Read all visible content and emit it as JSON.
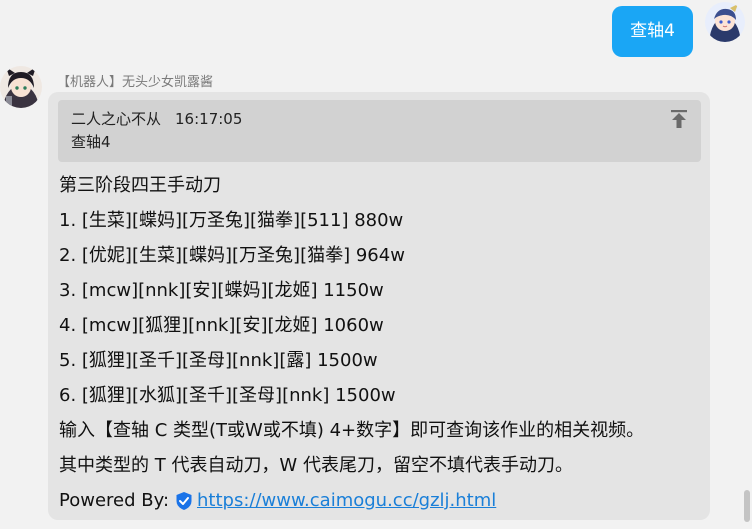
{
  "self_message": {
    "text": "查轴4"
  },
  "bot": {
    "name": "【机器人】无头少女凯露酱",
    "quote": {
      "author": "二人之心不从",
      "time": "16:17:05",
      "text": "查轴4"
    },
    "lines": [
      "第三阶段四王手动刀",
      "1. [生菜][蝶妈][万圣兔][猫拳][511] 880w",
      "2. [优妮][生菜][蝶妈][万圣兔][猫拳] 964w",
      "3. [mcw][nnk][安][蝶妈][龙姬] 1150w",
      "4. [mcw][狐狸][nnk][安][龙姬] 1060w",
      "5. [狐狸][圣千][圣母][nnk][露] 1500w",
      "6. [狐狸][水狐][圣千][圣母][nnk] 1500w",
      "输入【查轴 C 类型(T或W或不填) 4+数字】即可查询该作业的相关视频。",
      "其中类型的 T 代表自动刀，W 代表尾刀，留空不填代表手动刀。"
    ],
    "powered_by_label": "Powered By:",
    "link": "https://www.caimogu.cc/gzlj.html"
  },
  "colors": {
    "self_bubble": "#1aa6f5",
    "bot_bubble": "#e4e4e4",
    "quote_bg": "#d2d2d2",
    "link": "#1a7fd8",
    "shield": "#1a73e8"
  },
  "icons": {
    "pin": "pin-to-top-icon",
    "shield": "shield-check-icon"
  }
}
